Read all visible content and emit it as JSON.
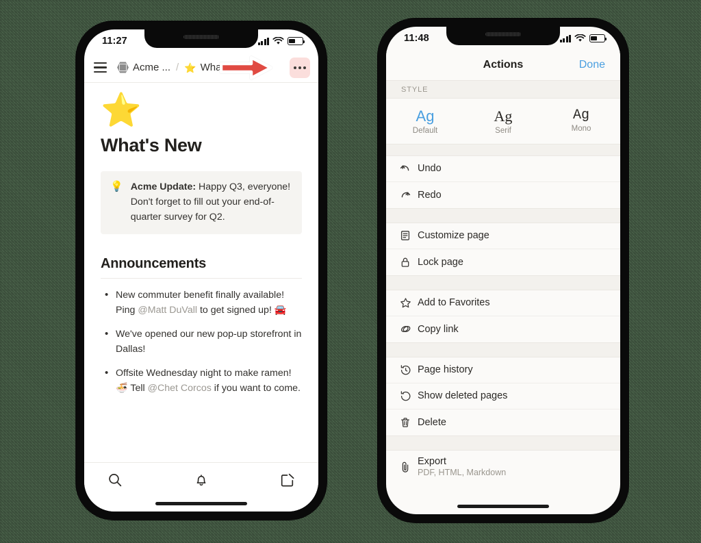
{
  "background": {
    "color": "#5e7d5e"
  },
  "phone_left": {
    "status_bar": {
      "time": "11:27",
      "signal_icon": "cellular-bars-icon",
      "wifi_icon": "wifi-icon",
      "battery_icon": "battery-icon"
    },
    "breadcrumb": {
      "menu_icon": "hamburger-menu-icon",
      "workspace_icon": "acme-hexagon-logo-icon",
      "workspace": "Acme ...",
      "separator": "/",
      "page_icon": "star-emoji-icon",
      "page": "What's ...",
      "overflow_label": "•••"
    },
    "annotation": {
      "arrow_icon": "red-right-arrow-icon",
      "color": "#e04a42",
      "highlight_color": "#fbdedc"
    },
    "page": {
      "hero_icon": "⭐",
      "title": "What's New",
      "callout": {
        "icon": "💡",
        "lead": "Acme Update:",
        "body": " Happy Q3, everyone! Don't forget to fill out your end-of-quarter survey for Q2."
      },
      "section_title": "Announcements",
      "bullets": [
        {
          "pre": "New commuter benefit finally available! Ping ",
          "mention": "@Matt DuVall",
          "post": " to get signed up! 🚘"
        },
        {
          "pre": "We've opened our new pop-up storefront in Dallas!",
          "mention": "",
          "post": ""
        },
        {
          "pre": "Offsite Wednesday night to make ramen! 🍜 Tell ",
          "mention": "@Chet Corcos",
          "post": " if you want to come."
        }
      ]
    },
    "tabbar": [
      {
        "name": "search-tab",
        "icon": "search-icon"
      },
      {
        "name": "notifications-tab",
        "icon": "bell-icon"
      },
      {
        "name": "compose-tab",
        "icon": "compose-icon"
      }
    ]
  },
  "phone_right": {
    "status_bar": {
      "time": "11:48",
      "signal_icon": "cellular-bars-icon",
      "wifi_icon": "wifi-icon",
      "battery_icon": "battery-icon"
    },
    "nav": {
      "title": "Actions",
      "done": "Done",
      "done_color": "#4a9fe0"
    },
    "style_section": {
      "header": "STYLE",
      "options": [
        {
          "sample": "Ag",
          "label": "Default",
          "selected": true
        },
        {
          "sample": "Ag",
          "label": "Serif",
          "selected": false
        },
        {
          "sample": "Ag",
          "label": "Mono",
          "selected": false
        }
      ]
    },
    "groups": [
      {
        "items": [
          {
            "icon": "undo-icon",
            "label": "Undo"
          },
          {
            "icon": "redo-icon",
            "label": "Redo"
          }
        ]
      },
      {
        "items": [
          {
            "icon": "page-customize-icon",
            "label": "Customize page"
          },
          {
            "icon": "lock-icon",
            "label": "Lock page"
          }
        ]
      },
      {
        "items": [
          {
            "icon": "star-outline-icon",
            "label": "Add to Favorites"
          },
          {
            "icon": "link-icon",
            "label": "Copy link"
          }
        ]
      },
      {
        "items": [
          {
            "icon": "history-clock-icon",
            "label": "Page history"
          },
          {
            "icon": "restore-icon",
            "label": "Show deleted pages"
          },
          {
            "icon": "trash-icon",
            "label": "Delete"
          }
        ]
      }
    ],
    "export": {
      "icon": "paperclip-icon",
      "label": "Export",
      "sub": "PDF, HTML, Markdown"
    }
  }
}
